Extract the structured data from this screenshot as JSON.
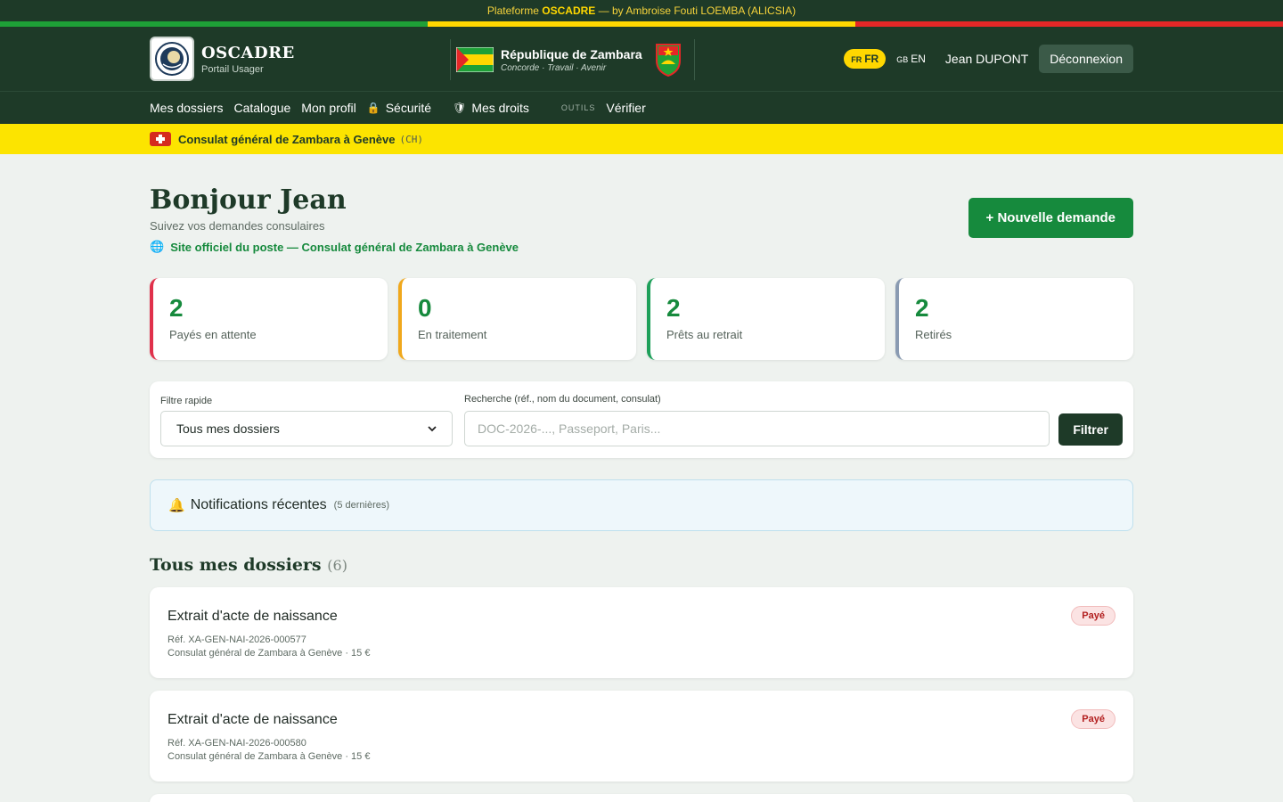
{
  "topbar": {
    "prefix": "Plateforme",
    "brand": "OSCADRE",
    "suffix": "— by Ambroise Fouti LOEMBA (ALICSIA)"
  },
  "colors": {
    "green": "#1ea037",
    "yellow": "#ffd700",
    "red": "#e42727",
    "accent_green": "#168a3d",
    "dark_green": "#1e3a28"
  },
  "header": {
    "logo_icon": "emblem-seal-icon",
    "brand_title": "OSCADRE",
    "brand_sub": "Portail Usager",
    "republic_name": "République de Zambara",
    "republic_motto": "Concorde · Travail · Avenir",
    "lang_fr_code": "FR",
    "lang_fr": "FR",
    "lang_en_code": "GB",
    "lang_en": "EN",
    "user_name": "Jean DUPONT",
    "logout_label": "Déconnexion"
  },
  "nav": {
    "items": [
      "Mes dossiers",
      "Catalogue",
      "Mon profil",
      "Sécurité",
      "Mes droits"
    ],
    "tools_label": "OUTILS",
    "verify_label": "Vérifier"
  },
  "consulat": {
    "name": "Consulat général de Zambara à Genève",
    "code": "(CH)"
  },
  "greeting": {
    "title": "Bonjour Jean",
    "subtitle": "Suivez vos demandes consulaires",
    "site_link": "Site officiel du poste — Consulat général de Zambara à Genève",
    "new_request": "+ Nouvelle demande"
  },
  "stats": [
    {
      "value": "2",
      "label": "Payés en attente",
      "color": "#e0314b"
    },
    {
      "value": "0",
      "label": "En traitement",
      "color": "#f0a81c"
    },
    {
      "value": "2",
      "label": "Prêts au retrait",
      "color": "#1ea05a"
    },
    {
      "value": "2",
      "label": "Retirés",
      "color": "#8a9bb2"
    }
  ],
  "filter": {
    "quick_label": "Filtre rapide",
    "quick_value": "Tous mes dossiers",
    "search_label": "Recherche (réf., nom du document, consulat)",
    "search_placeholder": "DOC-2026-..., Passeport, Paris...",
    "button": "Filtrer"
  },
  "notifications": {
    "title": "Notifications récentes",
    "count": "(5 dernières)"
  },
  "dossiers_section": {
    "title": "Tous mes dossiers",
    "count": "(6)"
  },
  "dossiers": [
    {
      "title": "Extrait d'acte de naissance",
      "ref": "Réf. XA-GEN-NAI-2026-000577",
      "meta": "Consulat général de Zambara à Genève · 15 €",
      "status": "Payé"
    },
    {
      "title": "Extrait d'acte de naissance",
      "ref": "Réf. XA-GEN-NAI-2026-000580",
      "meta": "Consulat général de Zambara à Genève · 15 €",
      "status": "Payé"
    }
  ]
}
